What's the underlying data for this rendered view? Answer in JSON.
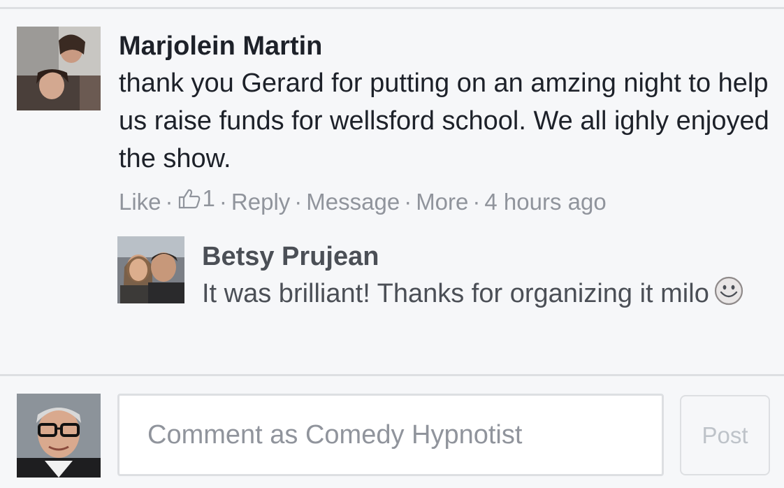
{
  "comment": {
    "author": "Marjolein Martin",
    "text": "thank you Gerard for putting on an amzing night to help us raise funds for wellsford school. We all ighly enjoyed the show.",
    "actions": {
      "like": "Like",
      "like_count": "1",
      "reply": "Reply",
      "message": "Message",
      "more": "More",
      "timestamp": "4 hours ago",
      "separator": "·"
    },
    "like_icon": "thumbs-up-icon"
  },
  "reply": {
    "author": "Betsy Prujean",
    "text": "It was brilliant! Thanks for organizing it milo",
    "emoji": "smile-emoji-icon"
  },
  "composer": {
    "placeholder": "Comment as Comedy Hypnotist",
    "value": "",
    "post_label": "Post"
  },
  "colors": {
    "background": "#f6f7f9",
    "primary_text": "#1d2129",
    "reply_text": "#4b4f56",
    "secondary_text": "#90949c",
    "divider": "#dddfe2",
    "post_disabled": "#bec3c9"
  }
}
